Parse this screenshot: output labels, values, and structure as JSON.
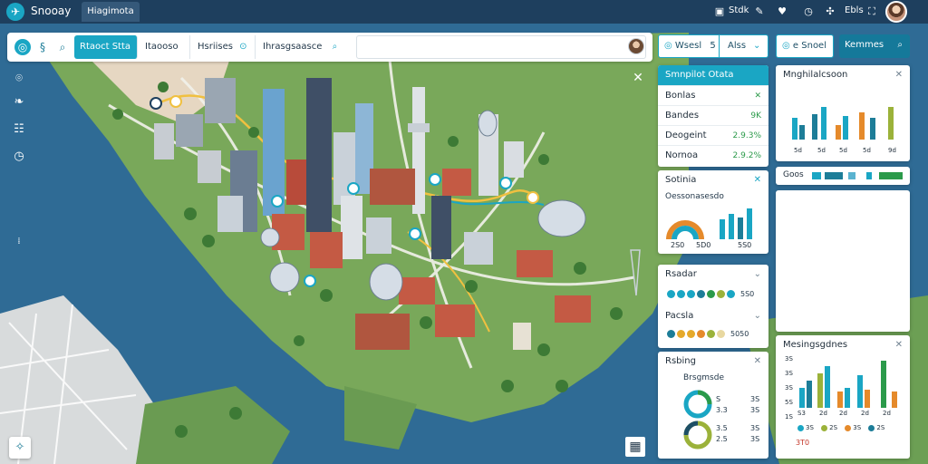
{
  "app": {
    "title": "Snooay",
    "tab_label": "Hiagimota",
    "top_texts": [
      "Stdk",
      "Ebls"
    ]
  },
  "toolbar": {
    "segments": [
      "Rtaoct Stta",
      "Itaooso",
      "Hsriises",
      "Ihrasgsaasce"
    ],
    "search_value": ""
  },
  "controls": {
    "group_left": "Wsesl",
    "group_left_value": "5",
    "group_right": "Alss",
    "send_label": "e Snoel",
    "metrics_label": "Kemmes"
  },
  "panel_stats": {
    "title": "Smnpilot Otata",
    "rows": [
      {
        "label": "Bonlas",
        "value": ""
      },
      {
        "label": "Bandes",
        "value": "9K"
      },
      {
        "label": "Deogeint",
        "value": "2.9.3%"
      },
      {
        "label": "Nornoa",
        "value": "2.9.2%"
      }
    ]
  },
  "panel_bars": {
    "title": "Sotinia",
    "subtitle": "Oessonasesdo",
    "bottom_labels": [
      "2S0",
      "5D0",
      "5S0"
    ]
  },
  "panel_dots": {
    "title1": "Rsadar",
    "count1": "5S0",
    "title2": "Pacsla",
    "count2": "5050"
  },
  "panel_donuts": {
    "title": "Rsbing",
    "subtitle": "Brsgmsde",
    "left_nums": [
      "S",
      "3.3",
      "3.5",
      "2.5"
    ],
    "right_nums": [
      "3S",
      "3S",
      "3S",
      "3S"
    ]
  },
  "panel_monthly": {
    "title": "Mnghilalcsoon",
    "labels": [
      "5d",
      "5d",
      "5d",
      "5d",
      "9d"
    ]
  },
  "panel_legend": {
    "title": "Goos"
  },
  "panel_messages": {
    "title": "Mesingsgdnes",
    "y_labels": [
      "3S",
      "3S",
      "3S",
      "5S",
      "1S"
    ],
    "x_labels": [
      "S3",
      "2d",
      "2d",
      "2d",
      "2d"
    ],
    "bottom_labels": [
      "3S",
      "2S",
      "3S",
      "2S",
      "3S"
    ],
    "footer": "3T0"
  },
  "colors": {
    "accent": "#1aa6c4",
    "header": "#1e3f5e",
    "green": "#2b9a4a",
    "orange": "#e58a2b",
    "olive": "#9bb23a"
  }
}
